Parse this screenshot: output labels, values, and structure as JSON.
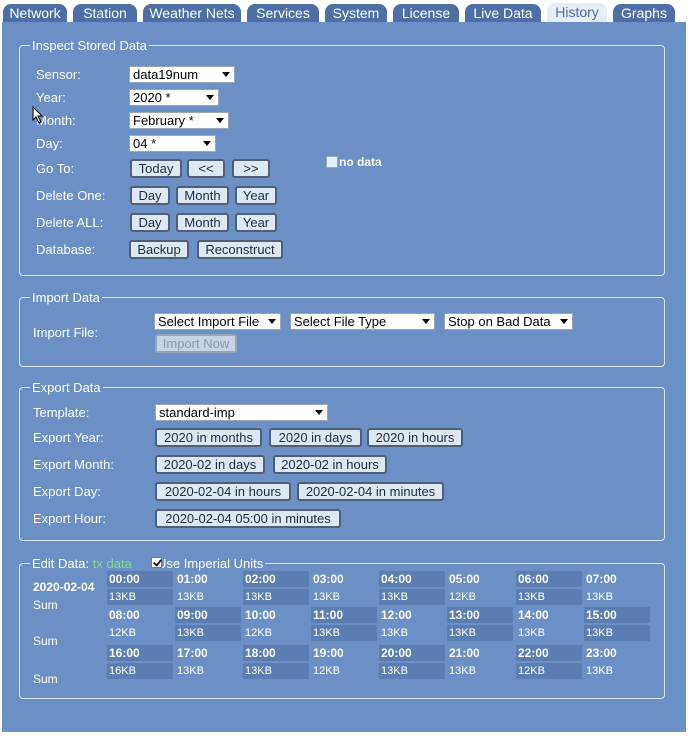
{
  "tabs": [
    {
      "label": "Network",
      "active": false
    },
    {
      "label": "Station",
      "active": false
    },
    {
      "label": "Weather Nets",
      "active": false
    },
    {
      "label": "Services",
      "active": false
    },
    {
      "label": "System",
      "active": false
    },
    {
      "label": "License",
      "active": false
    },
    {
      "label": "Live Data",
      "active": false
    },
    {
      "label": "History",
      "active": true
    },
    {
      "label": "Graphs",
      "active": false
    }
  ],
  "inspect": {
    "legend": "Inspect Stored Data",
    "sensor_label": "Sensor:",
    "sensor_value": "data19num",
    "year_label": "Year:",
    "year_value": "2020 *",
    "month_label": "Month:",
    "month_value": "February *",
    "day_label": "Day:",
    "day_value": "04 *",
    "goto_label": "Go To:",
    "today": "Today",
    "prev": "<<",
    "next": ">>",
    "no_data": "no data",
    "delete_one_label": "Delete One:",
    "delete_all_label": "Delete ALL:",
    "day_btn": "Day",
    "month_btn": "Month",
    "year_btn": "Year",
    "database_label": "Database:",
    "backup": "Backup",
    "reconstruct": "Reconstruct"
  },
  "import": {
    "legend": "Import Data",
    "file_label": "Import File:",
    "select_file": "Select Import File",
    "select_type": "Select File Type",
    "bad_data": "Stop on Bad Data",
    "import_now": "Import Now"
  },
  "export": {
    "legend": "Export Data",
    "template_label": "Template:",
    "template_value": "standard-imp",
    "year_label": "Export Year:",
    "year_buttons": [
      "2020 in months",
      "2020 in days",
      "2020 in hours"
    ],
    "month_label": "Export Month:",
    "month_buttons": [
      "2020-02 in days",
      "2020-02 in hours"
    ],
    "day_label": "Export Day:",
    "day_buttons": [
      "2020-02-04 in hours",
      "2020-02-04 in minutes"
    ],
    "hour_label": "Export Hour:",
    "hour_buttons": [
      "2020-02-04 05:00 in minutes"
    ]
  },
  "edit": {
    "legend_prefix": "Edit Data:",
    "legend_link": "tx data",
    "imperial_label": "Use Imperial Units",
    "imperial_checked": true,
    "date": "2020-02-04",
    "sum_label": "Sum",
    "hours": [
      {
        "time": "00:00",
        "size": "13KB"
      },
      {
        "time": "01:00",
        "size": "13KB"
      },
      {
        "time": "02:00",
        "size": "13KB"
      },
      {
        "time": "03:00",
        "size": "13KB"
      },
      {
        "time": "04:00",
        "size": "13KB"
      },
      {
        "time": "05:00",
        "size": "12KB"
      },
      {
        "time": "06:00",
        "size": "13KB"
      },
      {
        "time": "07:00",
        "size": "13KB"
      },
      {
        "time": "08:00",
        "size": "12KB"
      },
      {
        "time": "09:00",
        "size": "13KB"
      },
      {
        "time": "10:00",
        "size": "12KB"
      },
      {
        "time": "11:00",
        "size": "13KB"
      },
      {
        "time": "12:00",
        "size": "13KB"
      },
      {
        "time": "13:00",
        "size": "13KB"
      },
      {
        "time": "14:00",
        "size": "13KB"
      },
      {
        "time": "15:00",
        "size": "13KB"
      },
      {
        "time": "16:00",
        "size": "16KB"
      },
      {
        "time": "17:00",
        "size": "13KB"
      },
      {
        "time": "18:00",
        "size": "13KB"
      },
      {
        "time": "19:00",
        "size": "12KB"
      },
      {
        "time": "20:00",
        "size": "13KB"
      },
      {
        "time": "21:00",
        "size": "13KB"
      },
      {
        "time": "22:00",
        "size": "12KB"
      },
      {
        "time": "23:00",
        "size": "13KB"
      }
    ]
  },
  "colors": {
    "panel": "#6b90c6",
    "tab": "#4d6fa6",
    "tab_active": "#e6edf6",
    "cell_shade": "#5a7db2",
    "link": "#7fe08a"
  }
}
